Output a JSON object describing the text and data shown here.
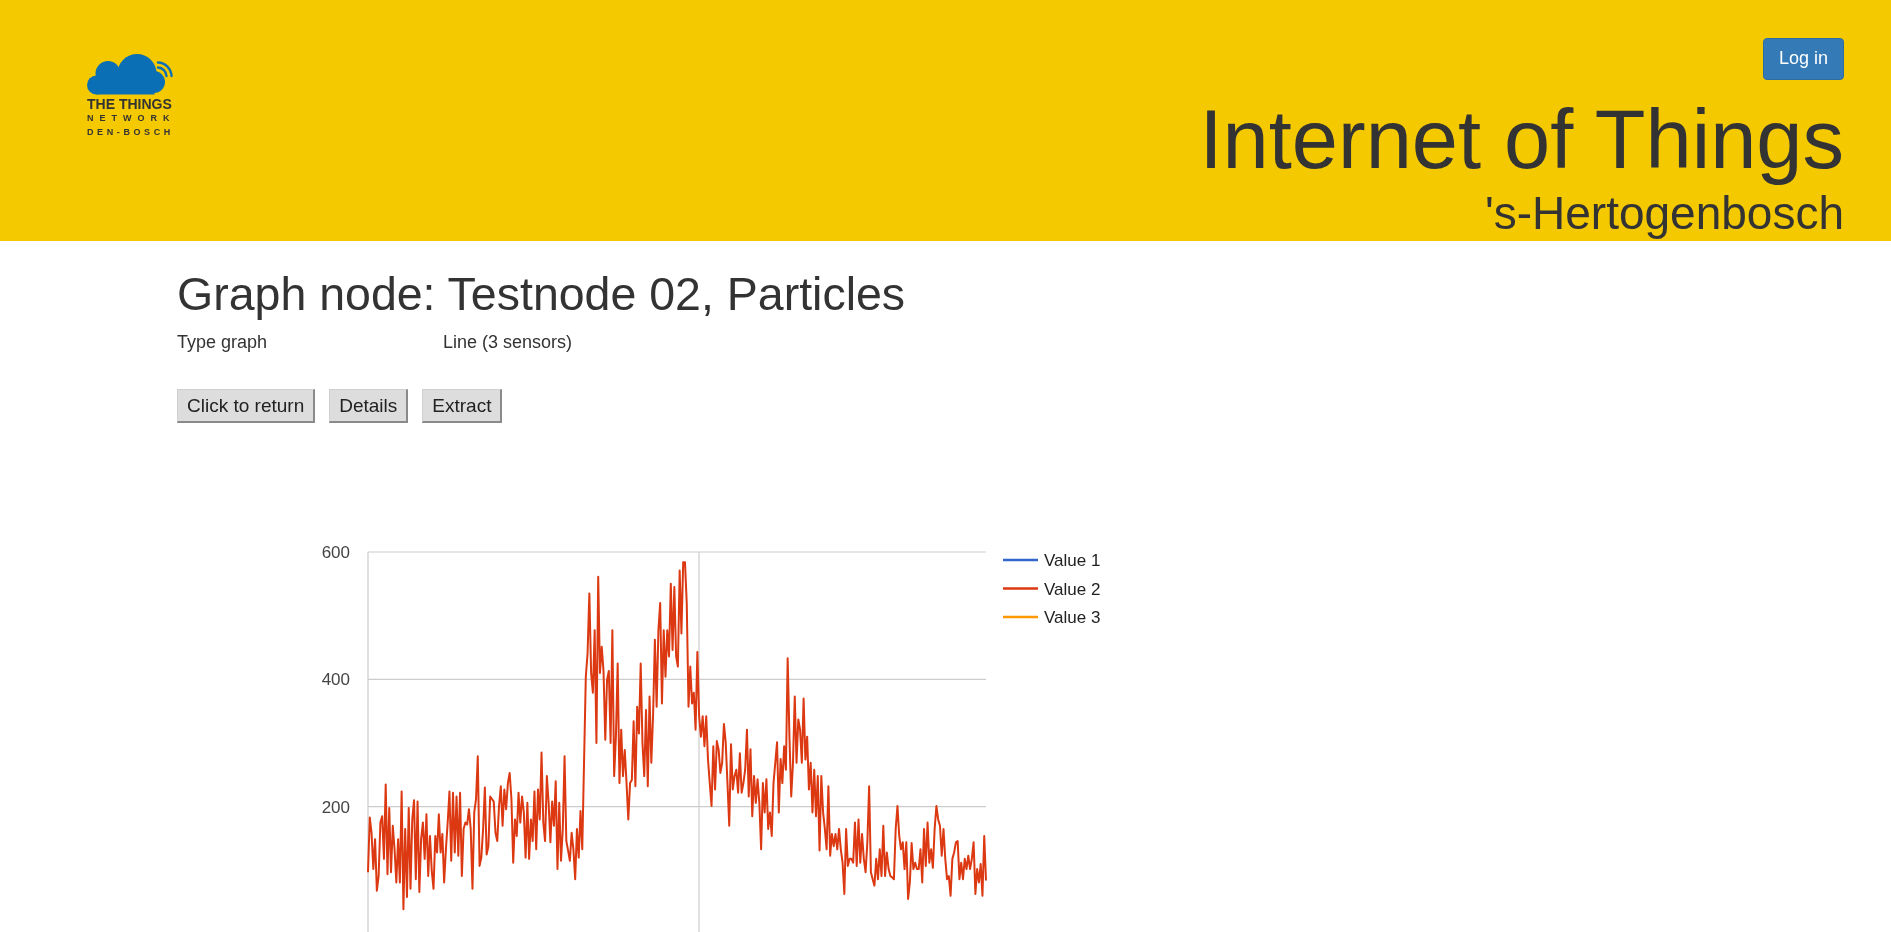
{
  "header": {
    "logo": {
      "line_1": "THE THINGS",
      "line_2": "NETWORK",
      "line_3": "DEN-BOSCH"
    },
    "login_button": "Log in",
    "title": "Internet of Things",
    "subtitle": "'s-Hertogenbosch"
  },
  "page": {
    "heading": "Graph node: Testnode 02, Particles",
    "properties": [
      {
        "label": "Type graph",
        "value": "Line (3 sensors)"
      }
    ],
    "buttons": [
      "Click to return",
      "Details",
      "Extract"
    ]
  },
  "chart": {
    "chart_data": {
      "type": "line",
      "ylim": [
        0,
        600
      ],
      "yticks": [
        200,
        400,
        600
      ],
      "series": [
        {
          "name": "Value 1",
          "color": "#3366cc"
        },
        {
          "name": "Value 2",
          "color": "#dc3912",
          "values": [
            97,
            183,
            159,
            102,
            149,
            68,
            91,
            175,
            185,
            118,
            235,
            94,
            198,
            97,
            170,
            133,
            81,
            149,
            81,
            224,
            39,
            165,
            58,
            198,
            71,
            180,
            210,
            86,
            208,
            66,
            149,
            175,
            118,
            188,
            91,
            154,
            99,
            71,
            154,
            128,
            188,
            128,
            157,
            81,
            133,
            175,
            224,
            115,
            222,
            128,
            216,
            123,
            222,
            91,
            165,
            175,
            172,
            196,
            165,
            71,
            191,
            212,
            279,
            107,
            120,
            165,
            230,
            125,
            138,
            216,
            212,
            208,
            159,
            146,
            201,
            232,
            170,
            227,
            196,
            237,
            253,
            212,
            112,
            180,
            154,
            222,
            175,
            216,
            191,
            120,
            206,
            118,
            180,
            146,
            224,
            133,
            227,
            180,
            285,
            175,
            146,
            248,
            206,
            144,
            208,
            170,
            240,
            102,
            206,
            115,
            165,
            279,
            146,
            131,
            115,
            159,
            133,
            86,
            165,
            120,
            193,
            133,
            269,
            404,
            441,
            535,
            410,
            379,
            477,
            300,
            561,
            410,
            451,
            413,
            305,
            399,
            413,
            300,
            477,
            248,
            310,
            425,
            237,
            321,
            248,
            289,
            237,
            180,
            237,
            242,
            334,
            232,
            357,
            315,
            425,
            300,
            248,
            352,
            232,
            373,
            269,
            344,
            462,
            357,
            477,
            520,
            362,
            477,
            404,
            477,
            436,
            550,
            446,
            545,
            436,
            420,
            571,
            472,
            584,
            584,
            520,
            357,
            420,
            362,
            379,
            321,
            443,
            342,
            310,
            342,
            295,
            342,
            274,
            237,
            201,
            295,
            227,
            303,
            290,
            253,
            269,
            330,
            301,
            237,
            170,
            298,
            227,
            248,
            258,
            222,
            284,
            222,
            237,
            258,
            321,
            216,
            290,
            185,
            248,
            206,
            243,
            206,
            133,
            237,
            191,
            243,
            165,
            191,
            154,
            237,
            269,
            301,
            191,
            275,
            237,
            295,
            258,
            433,
            310,
            216,
            269,
            373,
            269,
            337,
            321,
            269,
            370,
            274,
            310,
            227,
            269,
            191,
            258,
            185,
            248,
            131,
            248,
            191,
            165,
            133,
            232,
            123,
            157,
            138,
            157,
            133,
            165,
            133,
            112,
            63,
            165,
            107,
            118,
            118,
            112,
            175,
            107,
            180,
            112,
            157,
            118,
            97,
            144,
            232,
            97,
            86,
            76,
            118,
            86,
            133,
            91,
            170,
            91,
            128,
            102,
            91,
            89,
            86,
            165,
            201,
            154,
            133,
            144,
            102,
            144,
            55,
            81,
            143,
            102,
            112,
            102,
            102,
            133,
            81,
            165,
            107,
            175,
            112,
            133,
            104,
            165,
            201,
            180,
            170,
            123,
            165,
            118,
            86,
            91,
            60,
            118,
            128,
            144,
            146,
            86,
            112,
            86,
            118,
            102,
            123,
            102,
            118,
            144,
            63,
            102,
            81,
            110,
            60,
            154,
            84
          ]
        },
        {
          "name": "Value 3",
          "color": "#ff9900"
        }
      ]
    }
  }
}
